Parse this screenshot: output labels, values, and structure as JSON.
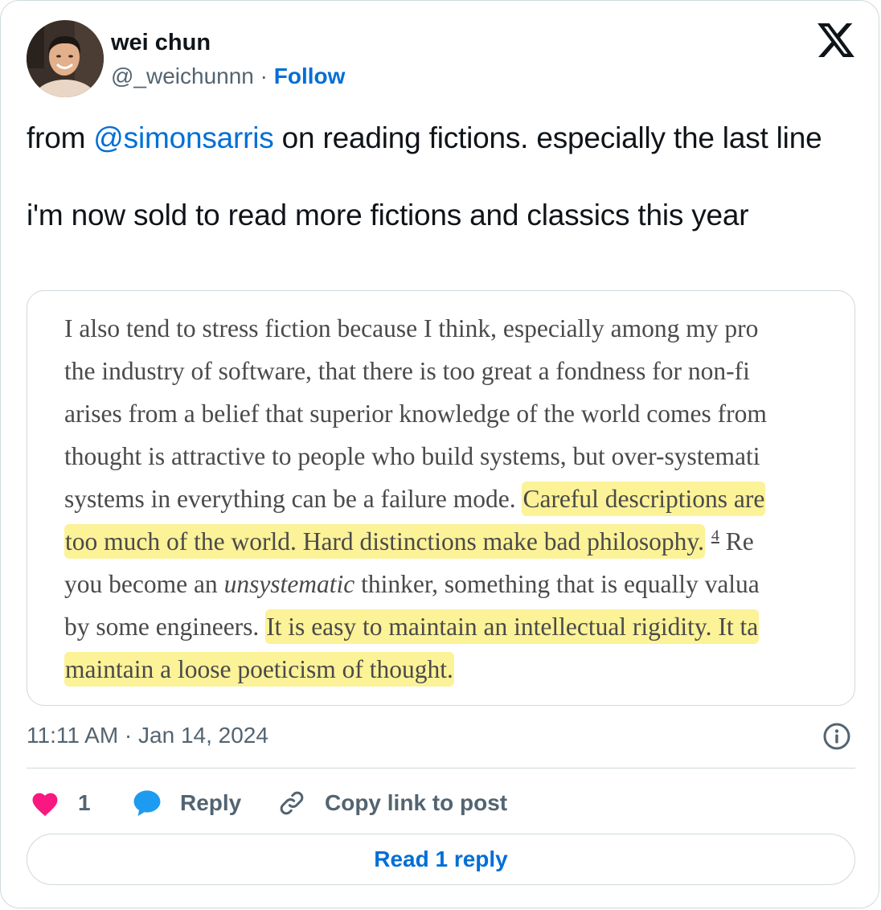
{
  "author": {
    "name": "wei chun",
    "handle": "@_weichunnn",
    "separator": "·",
    "follow_label": "Follow"
  },
  "brand": {
    "logo_icon": "x-logo-icon"
  },
  "tweet": {
    "prefix": "from ",
    "mention": "@simonsarris",
    "line1_rest": " on reading fictions. especially the last line",
    "line2": "i'm now sold to read more fictions and classics this year"
  },
  "excerpt": {
    "l1": "I also tend to stress fiction because I think, especially among my pro",
    "l2": "the industry of software, that there is too great a fondness for non-fi",
    "l3": "arises from a belief that superior knowledge of the world comes from",
    "l4": "thought is attractive to people who build systems, but over-systemati",
    "l5_plain": "systems in everything can be a failure mode. ",
    "l5_hl": "Careful descriptions are",
    "l6_hl": "too much of the world. Hard distinctions make bad philosophy.",
    "l6_footnote": "4",
    "l6_rest": " Re",
    "l7_pre": "you become an ",
    "l7_em": "unsystematic",
    "l7_post": " thinker, something that is equally valua",
    "l8_plain": "by some engineers. ",
    "l8_hl": "It is easy to maintain an intellectual rigidity. It ta",
    "l9_hl": "maintain a loose poeticism of thought."
  },
  "meta": {
    "timestamp": "11:11 AM · Jan 14, 2024",
    "info_icon": "info-icon"
  },
  "actions": {
    "like_count": "1",
    "reply_label": "Reply",
    "copy_label": "Copy link to post"
  },
  "footer": {
    "read_replies_label": "Read 1 reply"
  },
  "colors": {
    "link_blue": "#006fd6",
    "muted_gray": "#536471",
    "heart_pink": "#f91880",
    "reply_blue": "#1d9bf0",
    "highlight_yellow": "#fcf297",
    "border_gray": "#cfd9de"
  }
}
